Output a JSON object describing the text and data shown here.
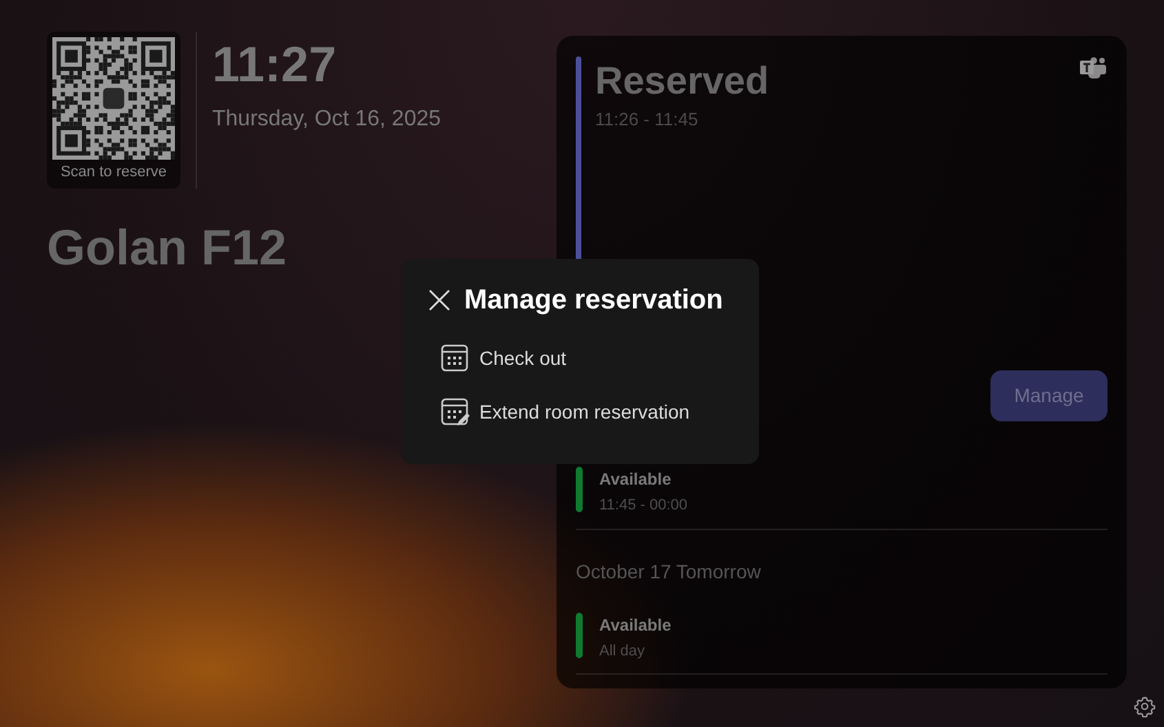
{
  "qr": {
    "caption": "Scan to reserve"
  },
  "clock": {
    "time": "11:27",
    "date": "Thursday, Oct 16, 2025"
  },
  "room": {
    "name": "Golan F12"
  },
  "current": {
    "status": "Reserved",
    "time": "11:26 - 11:45",
    "color": "#4b4f9a",
    "button": "Manage"
  },
  "schedule": [
    {
      "kind": "slot",
      "title": "Available",
      "time": "11:45 - 00:00",
      "color": "#0f7a30"
    },
    {
      "kind": "day",
      "title": "October 17 Tomorrow"
    },
    {
      "kind": "slot",
      "title": "Available",
      "time": "All day",
      "color": "#0f7a30"
    }
  ],
  "dialog": {
    "title": "Manage reservation",
    "options": [
      {
        "kind": "checkout",
        "label": "Check out"
      },
      {
        "kind": "extend",
        "label": "Extend room reservation"
      }
    ]
  }
}
